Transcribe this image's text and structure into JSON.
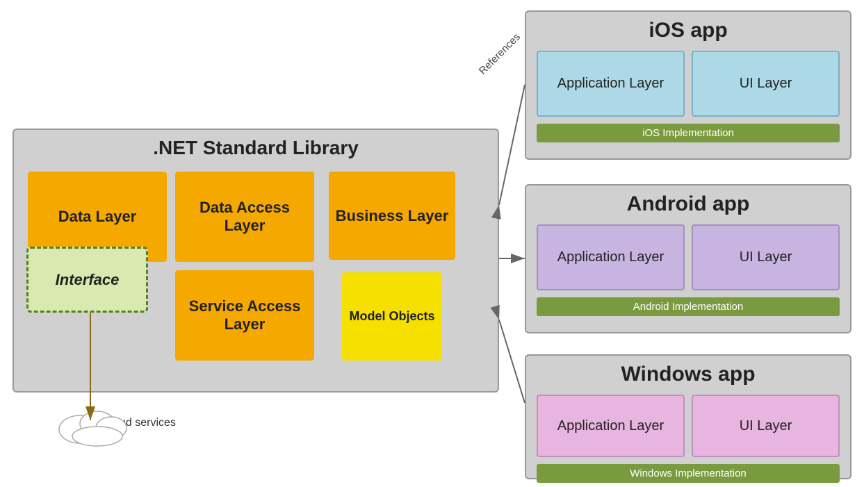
{
  "netLibrary": {
    "title": ".NET Standard Library",
    "layers": {
      "dataLayer": "Data Layer",
      "dataAccessLayer": "Data Access Layer",
      "businessLayer": "Business Layer",
      "interface": "Interface",
      "serviceAccessLayer": "Service Access Layer",
      "modelObjects": "Model Objects"
    }
  },
  "iosApp": {
    "title": "iOS app",
    "applicationLayer": "Application Layer",
    "uiLayer": "UI Layer",
    "implementation": "iOS Implementation"
  },
  "androidApp": {
    "title": "Android app",
    "applicationLayer": "Application Layer",
    "uiLayer": "UI Layer",
    "implementation": "Android Implementation"
  },
  "windowsApp": {
    "title": "Windows app",
    "applicationLayer": "Application Layer",
    "uiLayer": "UI Layer",
    "implementation": "Windows Implementation"
  },
  "arrows": {
    "referencesLabel": "References"
  },
  "cloud": {
    "label": "Cloud services"
  }
}
